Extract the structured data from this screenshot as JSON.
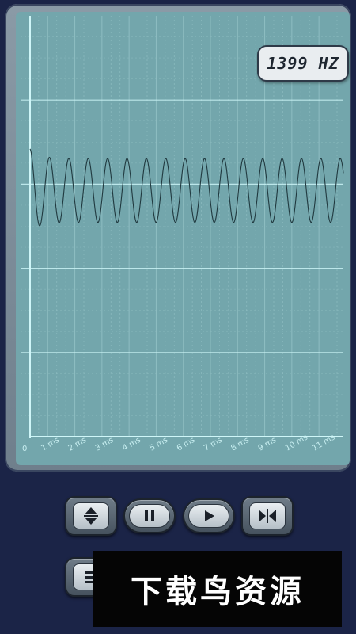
{
  "frequency": {
    "value": 1399,
    "unit": "HZ",
    "display": "1399 HZ"
  },
  "chart_data": {
    "type": "line",
    "x_ticks": [
      "0",
      "1 ms",
      "2 ms",
      "3 ms",
      "4 ms",
      "5 ms",
      "6 ms",
      "7 ms",
      "8 ms",
      "9 ms",
      "10 ms",
      "11 ms"
    ],
    "xlim_ms": [
      0,
      11.9
    ],
    "signal": {
      "shape": "sine",
      "frequency_hz": 1399,
      "amplitude_divisions": 0.38,
      "initial_overshoot": 0.3
    },
    "grid": true,
    "major_horizontal_lines": 4
  },
  "controls": {
    "buttons": [
      {
        "name": "vertical-scale-button",
        "icon": "vertical-arrows-icon"
      },
      {
        "name": "pause-button",
        "icon": "pause-icon"
      },
      {
        "name": "play-button",
        "icon": "play-icon"
      },
      {
        "name": "horizontal-scale-button",
        "icon": "horizontal-collapse-icon"
      }
    ]
  },
  "watermark": {
    "text": "下载鸟资源"
  },
  "colors": {
    "background": "#1b2447",
    "screen": "#73a6ac",
    "grid_minor": "#92c0c4",
    "grid_major": "#c9f3f5",
    "axis": "#cff6f8",
    "trace": "#20393f",
    "tick_label": "#c7eef0"
  }
}
